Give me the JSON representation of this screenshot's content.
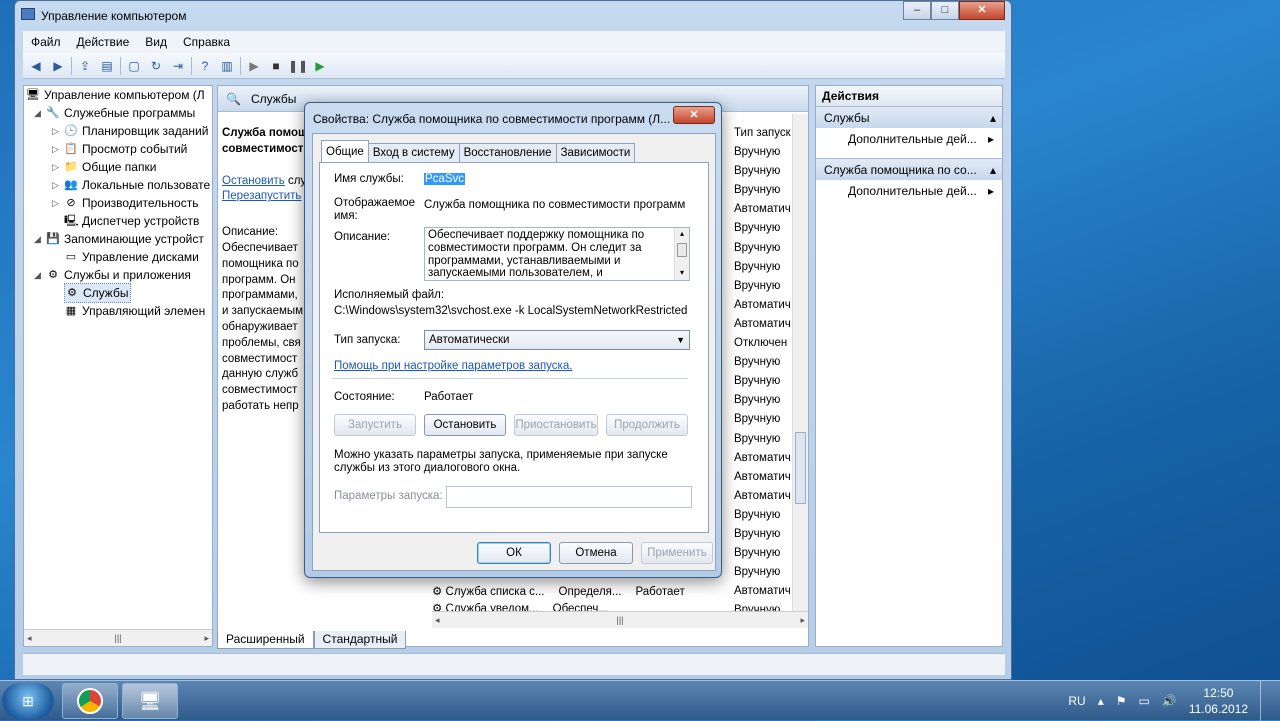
{
  "window": {
    "title": "Управление компьютером",
    "min": "–",
    "max": "□",
    "close": "✕"
  },
  "menu": [
    "Файл",
    "Действие",
    "Вид",
    "Справка"
  ],
  "tree": {
    "items": [
      {
        "label": "Управление компьютером (Л",
        "exp": "",
        "icon": "🖥"
      },
      {
        "label": "Служебные программы",
        "exp": "◢",
        "icon": "🔧"
      },
      {
        "label": "Планировщик заданий",
        "exp": "▷",
        "icon": "🕒"
      },
      {
        "label": "Просмотр событий",
        "exp": "▷",
        "icon": "📋"
      },
      {
        "label": "Общие папки",
        "exp": "▷",
        "icon": "📁"
      },
      {
        "label": "Локальные пользовате",
        "exp": "▷",
        "icon": "👥"
      },
      {
        "label": "Производительность",
        "exp": "▷",
        "icon": "⊘"
      },
      {
        "label": "Диспетчер устройств",
        "exp": "",
        "icon": "🖳"
      },
      {
        "label": "Запоминающие устройст",
        "exp": "◢",
        "icon": "💾"
      },
      {
        "label": "Управление дисками",
        "exp": "",
        "icon": "▭"
      },
      {
        "label": "Службы и приложения",
        "exp": "◢",
        "icon": "⚙"
      },
      {
        "label": "Службы",
        "exp": "",
        "icon": "⚙"
      },
      {
        "label": "Управляющий элемен",
        "exp": "",
        "icon": "▦"
      }
    ]
  },
  "center": {
    "header": "Службы",
    "desc_title_1": "Служба помощн",
    "desc_title_2": "совместимости",
    "link_stop": "Остановить",
    "link_stop_rest": " слу",
    "link_restart": "Перезапустить",
    "desc_label": "Описание:",
    "desc_lines": [
      "Обеспечивает",
      "помощника по",
      "программ. Он",
      "программами,",
      "и запускаемым",
      "обнаруживает",
      "проблемы, свя",
      "совместимост",
      "данную служб",
      "совместимост",
      "работать непр"
    ],
    "type_header": "Тип запуск",
    "types": [
      "Вручную",
      "Вручную",
      "Вручную",
      "Автоматич",
      "Вручную",
      "Вручную",
      "Вручную",
      "Вручную",
      "Автоматич",
      "Автоматич",
      "Отключен",
      "Вручную",
      "Вручную",
      "Вручную",
      "Вручную",
      "Вручную",
      "Автоматич",
      "Автоматич",
      "Автоматич",
      "Вручную",
      "Вручную",
      "Вручную",
      "Вручную",
      "Автоматич",
      "Вручную"
    ],
    "bottom_rows": [
      {
        "name": "Служба списка с...",
        "desc": "Определя...",
        "state": "Работает"
      },
      {
        "name": "Служба уведом...",
        "desc": "Обеспеч...",
        "state": ""
      }
    ],
    "tab_ext": "Расширенный",
    "tab_std": "Стандартный"
  },
  "actions": {
    "title": "Действия",
    "groups": [
      {
        "label": "Службы",
        "item": "Дополнительные дей..."
      },
      {
        "label": "Служба помощника по со...",
        "item": "Дополнительные дей..."
      }
    ]
  },
  "dialog": {
    "title": "Свойства: Служба помощника по совместимости программ (Л...",
    "close": "✕",
    "tabs": [
      "Общие",
      "Вход в систему",
      "Восстановление",
      "Зависимости"
    ],
    "service_name_label": "Имя службы:",
    "service_name": "PcaSvc",
    "display_name_label_1": "Отображаемое",
    "display_name_label_2": "имя:",
    "display_name": "Служба помощника по совместимости программ",
    "description_label": "Описание:",
    "description": "Обеспечивает поддержку помощника по совместимости программ. Он следит за программами, устанавливаемыми и запускаемыми пользователем, и обнаруживает",
    "exe_label": "Исполняемый файл:",
    "exe_path": "C:\\Windows\\system32\\svchost.exe -k LocalSystemNetworkRestricted",
    "startup_label": "Тип запуска:",
    "startup_value": "Автоматически",
    "help_link": "Помощь при настройке параметров запуска.",
    "state_label": "Состояние:",
    "state_value": "Работает",
    "btn_start": "Запустить",
    "btn_stop": "Остановить",
    "btn_pause": "Приостановить",
    "btn_resume": "Продолжить",
    "hint_1": "Можно указать параметры запуска, применяемые при запуске",
    "hint_2": "службы из этого диалогового окна.",
    "params_label": "Параметры запуска:",
    "ok": "ОК",
    "cancel": "Отмена",
    "apply": "Применить"
  },
  "taskbar": {
    "lang": "RU",
    "time": "12:50",
    "date": "11.06.2012"
  }
}
